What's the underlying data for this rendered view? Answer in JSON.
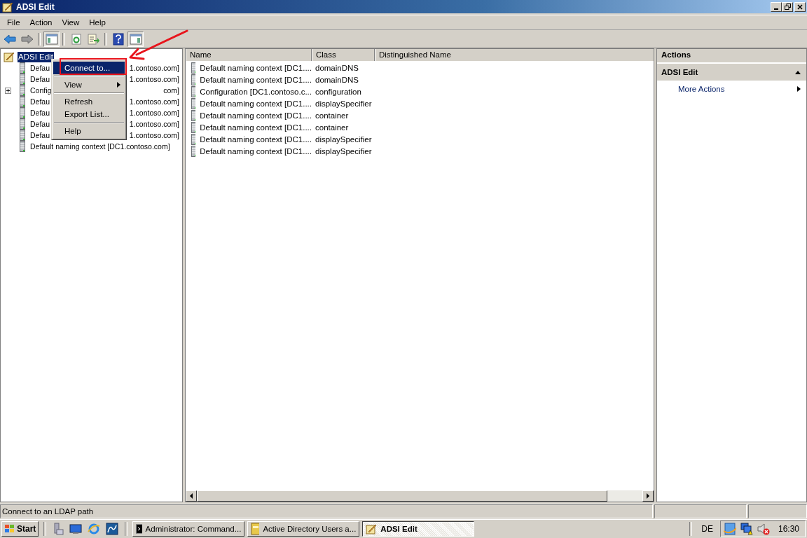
{
  "window": {
    "title": "ADSI Edit"
  },
  "menu_bar": [
    "File",
    "Action",
    "View",
    "Help"
  ],
  "toolbar": [
    {
      "kind": "back",
      "pressed": false
    },
    {
      "kind": "forward",
      "pressed": false
    },
    {
      "kind": "sep"
    },
    {
      "kind": "tree",
      "pressed": true
    },
    {
      "kind": "sep"
    },
    {
      "kind": "refresh",
      "pressed": false
    },
    {
      "kind": "export",
      "pressed": false
    },
    {
      "kind": "sep"
    },
    {
      "kind": "help",
      "pressed": false
    },
    {
      "kind": "actionpane",
      "pressed": true
    }
  ],
  "tree": {
    "label": "ADSI Edit",
    "selected": true,
    "children": [
      {
        "label": "Defau",
        "tail": "1.contoso.com]",
        "expandable": false
      },
      {
        "label": "Defau",
        "tail": "1.contoso.com]",
        "expandable": false
      },
      {
        "label": "Config",
        "tail": "com]",
        "expandable": true
      },
      {
        "label": "Defau",
        "tail": "1.contoso.com]",
        "expandable": false
      },
      {
        "label": "Defau",
        "tail": "1.contoso.com]",
        "expandable": false
      },
      {
        "label": "Defau",
        "tail": "1.contoso.com]",
        "expandable": false
      },
      {
        "label": "Defau",
        "tail": "1.contoso.com]",
        "expandable": false
      },
      {
        "label": "Default naming context [DC1.contoso.com]",
        "expandable": false
      }
    ]
  },
  "context_menu": [
    {
      "kind": "item",
      "label": "Connect to...",
      "selected": true,
      "submenu": false
    },
    {
      "kind": "separator"
    },
    {
      "kind": "item",
      "label": "View",
      "selected": false,
      "submenu": true
    },
    {
      "kind": "separator"
    },
    {
      "kind": "item",
      "label": "Refresh",
      "selected": false,
      "submenu": false
    },
    {
      "kind": "item",
      "label": "Export List...",
      "selected": false,
      "submenu": false
    },
    {
      "kind": "separator"
    },
    {
      "kind": "item",
      "label": "Help",
      "selected": false,
      "submenu": false
    }
  ],
  "table": {
    "columns": [
      "Name",
      "Class",
      "Distinguished Name"
    ],
    "rows": [
      [
        "Default naming context [DC1....",
        "domainDNS"
      ],
      [
        "Default naming context [DC1....",
        "domainDNS"
      ],
      [
        "Configuration [DC1.contoso.c...",
        "configuration"
      ],
      [
        "Default naming context [DC1....",
        "displaySpecifier"
      ],
      [
        "Default naming context [DC1....",
        "container"
      ],
      [
        "Default naming context [DC1....",
        "container"
      ],
      [
        "Default naming context [DC1....",
        "displaySpecifier"
      ],
      [
        "Default naming context [DC1....",
        "displaySpecifier"
      ]
    ]
  },
  "actions": {
    "title": "Actions",
    "section": "ADSI Edit",
    "expanded": true,
    "items": [
      "More Actions"
    ]
  },
  "status_bar": "Connect to an LDAP path",
  "taskbar": {
    "start": "Start",
    "tasks": [
      {
        "label": "Administrator: Command...",
        "kind": "cmd",
        "selected": false
      },
      {
        "label": "Active Directory Users a...",
        "kind": "book",
        "selected": false
      },
      {
        "label": "ADSI Edit",
        "kind": "adsi",
        "selected": true
      }
    ],
    "language": "DE",
    "clock": "16:30"
  }
}
